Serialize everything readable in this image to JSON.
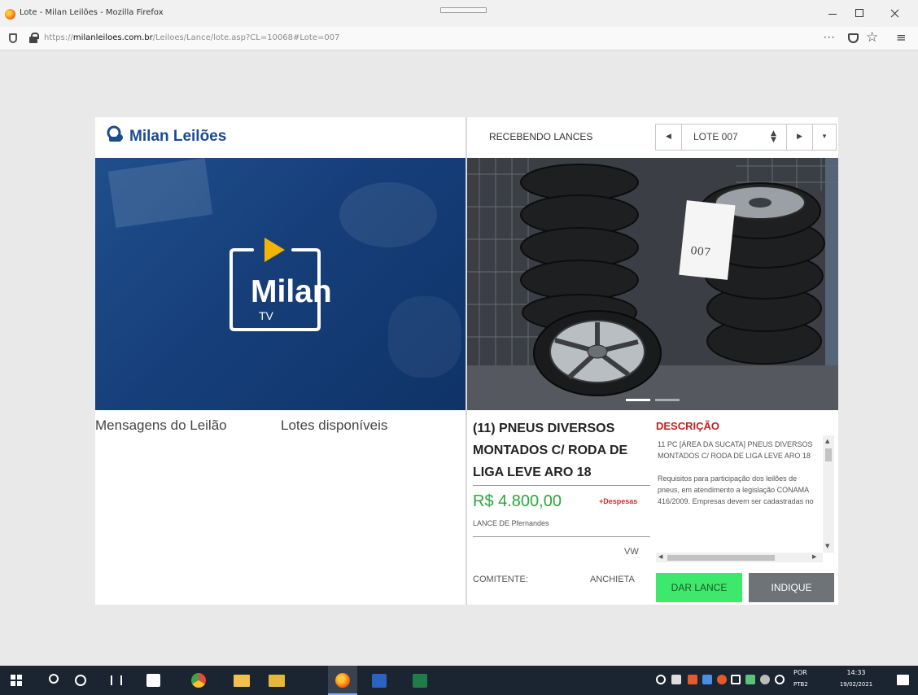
{
  "browser": {
    "window_title": "Lote - Milan Leilões - Mozilla Firefox",
    "url_prefix": "https://",
    "url_host": "milanleiloes.com.br",
    "url_path": "/Leiloes/Lance/lote.asp?CL=10068#Lote=007",
    "more_label": "···"
  },
  "site": {
    "brand": "Milan Leilões",
    "brand_color": "#1c4a8f"
  },
  "player": {
    "logo_brand": "Milan",
    "logo_sub": "TV",
    "play_color": "#f5b400"
  },
  "left_tabs": {
    "messages": "Mensagens do Leilão",
    "lots": "Lotes disponíveis"
  },
  "lot_header": {
    "status": "RECEBENDO LANCES",
    "selected_lot": "LOTE 007"
  },
  "lot": {
    "title": "(11) PNEUS DIVERSOS MONTADOS C/ RODA DE LIGA LEVE ARO 18",
    "price": "R$ 4.800,00",
    "expenses_link": "+Despesas",
    "bidder": "LANCE DE Pfernandes",
    "consignor_label": "COMITENTE:",
    "consignor_line1": "VW",
    "consignor_line2": "ANCHIETA",
    "tag_label": "007",
    "price_color": "#2aa63c"
  },
  "description": {
    "heading": "DESCRIÇÃO",
    "para1": "11 PC [ÁREA DA SUCATA] PNEUS DIVERSOS MONTADOS C/ RODA DE LIGA LEVE ARO 18",
    "para2": "Requisitos para participação dos leilões de pneus, em atendimento a legislação CONAMA 416/2009.",
    "para3": "Empresas devem ser cadastradas no",
    "heading_color": "#c81f1f"
  },
  "buttons": {
    "bid": "DAR LANCE",
    "indicate": "INDIQUE",
    "bid_color": "#3ee86d",
    "indicate_color": "#6e7378"
  },
  "carousel": {
    "slides": 2,
    "active_slide": 1
  },
  "taskbar": {
    "lang_line1": "POR",
    "lang_line2": "PTB2",
    "time": "14:33",
    "date": "19/02/2021"
  }
}
